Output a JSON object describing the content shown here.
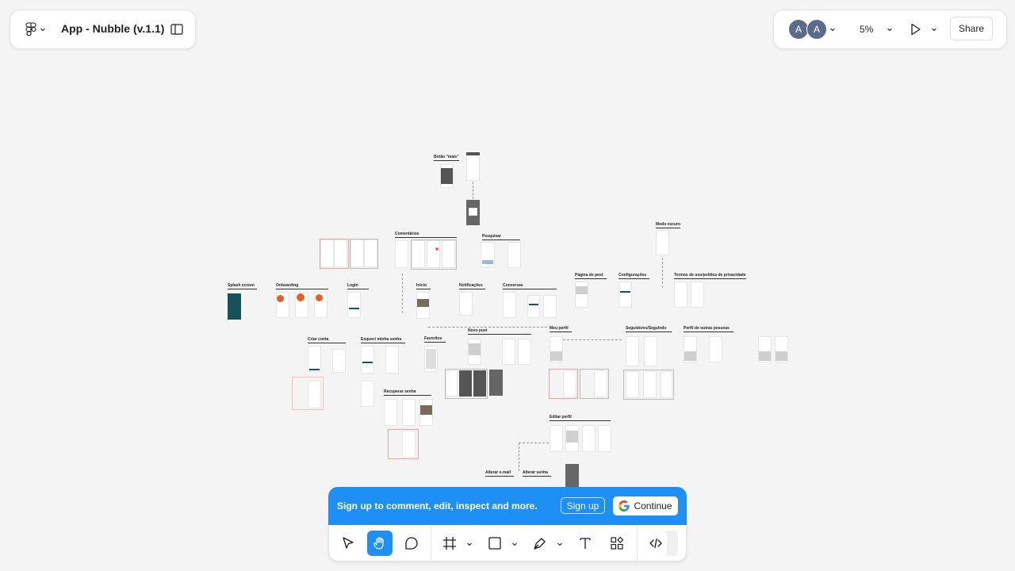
{
  "header": {
    "file_title": "App - Nubble (v.1.1)",
    "menu_icon": "figma-logo-icon",
    "sidebar_toggle_icon": "panel-toggle-icon"
  },
  "topright": {
    "avatars": [
      "A",
      "A"
    ],
    "zoom": "5%",
    "share_label": "Share",
    "present_icon": "play-icon"
  },
  "canvas_labels": {
    "botao_mais": "Botão \"mais\"",
    "comentarios": "Comentários",
    "pesquisar": "Pesquisar",
    "modo_escuro": "Modo escuro",
    "splash": "Splash screen",
    "onboarding": "Onboarding",
    "login": "Login",
    "inicio": "Início",
    "notificacoes": "Notificações",
    "conversas": "Conversas",
    "pagina_post": "Página de post",
    "configuracoes": "Configurações",
    "termos": "Termos de uso/política de privacidade",
    "criar_conta": "Criar conta",
    "esqueci": "Esqueci minha senha",
    "favoritos": "Favoritos",
    "novo_post": "Novo post",
    "meu_perfil": "Meu perfil",
    "seguidores": "Seguidores/Seguindo",
    "perfil_outras": "Perfil de outras pessoas",
    "recuperar": "Recuperar senha",
    "editar_perfil": "Editar perfil",
    "alterar_email": "Alterar e-mail",
    "alterar_senha": "Alterar senha"
  },
  "banner": {
    "message": "Sign up to comment, edit, inspect and more.",
    "signup_label": "Sign up",
    "continue_label": "Continue",
    "bg_color": "#1e90f5"
  },
  "toolbar": {
    "tools": [
      "move-icon",
      "hand-icon",
      "comment-icon",
      "frame-icon",
      "rectangle-icon",
      "pen-icon",
      "text-icon",
      "components-icon",
      "dev-mode-icon"
    ],
    "active_tool": "hand-icon"
  }
}
